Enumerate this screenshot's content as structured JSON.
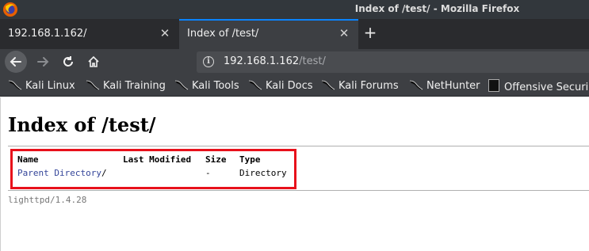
{
  "window": {
    "title": "Index of /test/ - Mozilla Firefox",
    "logo_icon": "firefox-logo-icon"
  },
  "tabs": [
    {
      "label": "192.168.1.162/",
      "active": false
    },
    {
      "label": "Index of /test/",
      "active": true
    }
  ],
  "nav": {
    "url_host": "192.168.1.162",
    "url_path": "/test/"
  },
  "bookmarks": [
    {
      "label": "Kali Linux",
      "icon": "kali-dragon-icon"
    },
    {
      "label": "Kali Training",
      "icon": "kali-dragon-icon"
    },
    {
      "label": "Kali Tools",
      "icon": "kali-dragon-icon"
    },
    {
      "label": "Kali Docs",
      "icon": "kali-dragon-icon"
    },
    {
      "label": "Kali Forums",
      "icon": "kali-dragon-icon"
    },
    {
      "label": "NetHunter",
      "icon": "kali-dragon-icon"
    },
    {
      "label": "Offensive Securi",
      "icon": "offsec-icon"
    }
  ],
  "page": {
    "title": "Index of /test/",
    "table": {
      "headers": [
        "Name",
        "Last Modified",
        "Size",
        "Type"
      ],
      "rows": [
        {
          "name": "Parent Directory",
          "suffix": "/",
          "modified": "",
          "size": "-",
          "type": "Directory"
        }
      ]
    },
    "footer": "lighttpd/1.4.28"
  },
  "colors": {
    "highlight": "#e8111b",
    "link": "#334499",
    "tab_accent": "#0a84ff"
  }
}
